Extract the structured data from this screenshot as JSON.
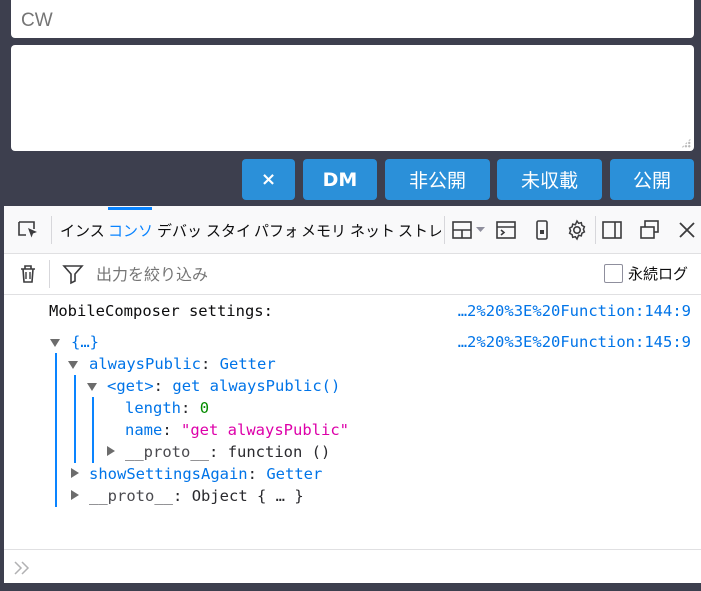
{
  "composer": {
    "cw_placeholder": "CW",
    "buttons": {
      "close": "×",
      "dm": "DM",
      "private": "非公開",
      "unlisted": "未収載",
      "public": "公開"
    }
  },
  "devtools": {
    "tabs": [
      "インス",
      "コンソ",
      "デバッ",
      "スタイ",
      "パフォ",
      "メモリ",
      "ネット",
      "ストレ"
    ],
    "active_tab_index": 1,
    "filter_placeholder": "出力を絞り込み",
    "persist_logs_label": "永続ログ",
    "persist_logs_checked": false,
    "accent_color": "#0a84ff",
    "icons": [
      "element-picker-icon",
      "responsive-design-icon",
      "console-dropdown-icon",
      "screenshot-icon",
      "settings-gear-icon",
      "dock-side-icon",
      "undock-window-icon",
      "close-icon",
      "trash-icon",
      "filter-funnel-icon",
      "prompt-chevron-icon"
    ]
  },
  "console": {
    "messages": [
      {
        "text": "MobileComposer settings:",
        "location": "…2%20%3E%20Function:144:9"
      },
      {
        "text": "{…}",
        "location": "…2%20%3E%20Function:145:9"
      }
    ],
    "tree": {
      "alwaysPublic_key": "alwaysPublic",
      "alwaysPublic_val": "Getter",
      "get_key": "<get>",
      "get_val": "get alwaysPublic()",
      "length_key": "length",
      "length_val": "0",
      "name_key": "name",
      "name_val": "\"get alwaysPublic\"",
      "inner_proto_key": "__proto__",
      "inner_proto_val": "function ()",
      "showSettings_key": "showSettingsAgain",
      "showSettings_val": "Getter",
      "outer_proto_key": "__proto__",
      "outer_proto_val": "Object { … }",
      "colon": ":"
    }
  }
}
